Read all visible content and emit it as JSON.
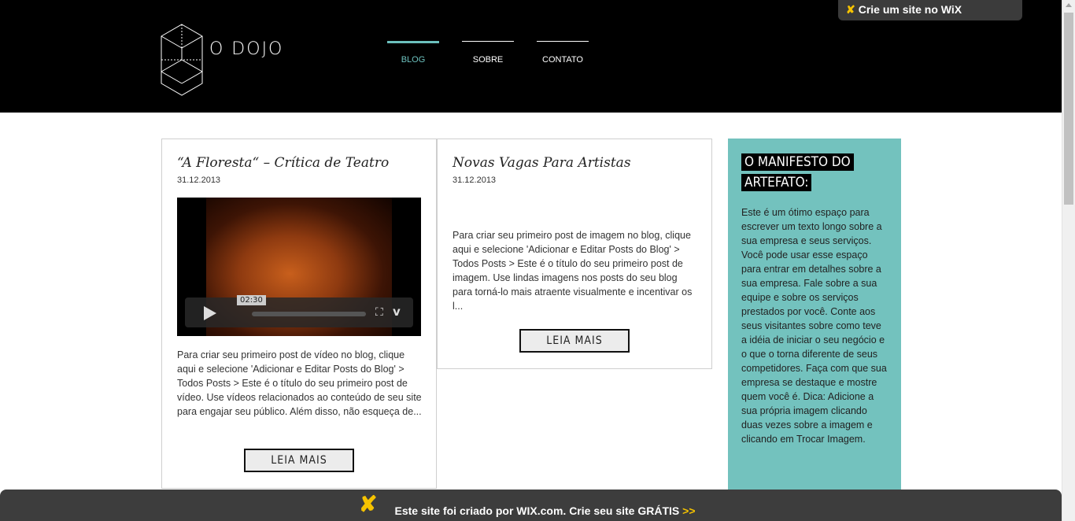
{
  "header": {
    "logo_text": "O DOJO",
    "nav": [
      {
        "label": "BLOG"
      },
      {
        "label": "SOBRE"
      },
      {
        "label": "CONTATO"
      }
    ]
  },
  "wix_top": {
    "label": "Crie um site no WiX"
  },
  "posts": [
    {
      "title": "“A Floresta“ – Crítica de Teatro",
      "date": "31.12.2013",
      "video_time": "02:30",
      "text": "Para criar seu primeiro post de vídeo no blog, clique aqui e selecione 'Adicionar e Editar Posts do Blog' > Todos Posts > Este é o título do seu primeiro post de vídeo. Use vídeos relacionados ao conteúdo de seu site para engajar seu público. Além disso, não esqueça de...",
      "read_more": "LEIA MAIS"
    },
    {
      "title": "Novas Vagas Para Artistas",
      "date": "31.12.2013",
      "text": "Para criar seu primeiro post de imagem no blog, clique aqui e selecione 'Adicionar e Editar Posts do Blog' > Todos Posts > Este é o título do seu primeiro post de imagem. Use lindas imagens nos posts do seu blog para torná-lo mais atraente visualmente e incentivar os l...",
      "read_more": "LEIA MAIS"
    }
  ],
  "sidebar": {
    "title_line1": "O MANIFESTO DO",
    "title_line2": "ARTEFATO:",
    "text": "Este é um ótimo espaço para escrever um texto longo sobre a sua empresa e seus serviços. Você pode usar esse espaço para entrar em detalhes sobre a sua empresa. Fale sobre a sua equipe e sobre os serviços prestados por você. Conte aos seus visitantes sobre como teve a idéia de iniciar o seu negócio e o que o torna diferente de seus competidores. Faça com que sua empresa se destaque e mostre quem você é. Dica: Adicione a sua própria imagem clicando duas vezes sobre a imagem e clicando em Trocar Imagem."
  },
  "wix_bottom": {
    "label": "Este site foi criado por WIX.com. Crie seu site GRÁTIS",
    "arrows": ">>"
  },
  "colors": {
    "accent": "#6cc0bd",
    "sidebar_bg": "#73c2be",
    "wix_yellow": "#f6c300"
  }
}
